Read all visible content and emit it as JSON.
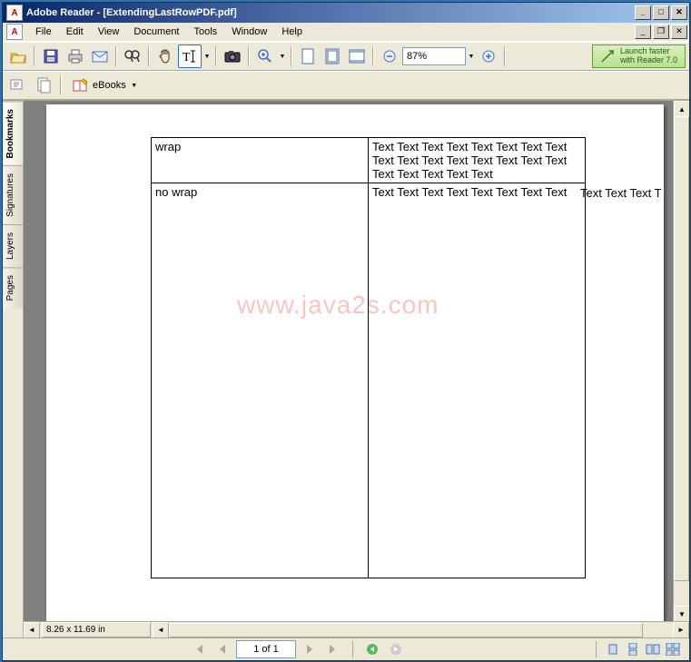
{
  "titlebar": {
    "app_name": "Adobe Reader",
    "doc_name": "[ExtendingLastRowPDF.pdf]"
  },
  "menu": {
    "file": "File",
    "edit": "Edit",
    "view": "View",
    "document": "Document",
    "tools": "Tools",
    "window": "Window",
    "help": "Help"
  },
  "toolbar": {
    "zoom_pct": "87%",
    "promo_line1": "Launch faster",
    "promo_line2": "with Reader 7.0",
    "ebooks": "eBooks"
  },
  "sidebar": {
    "bookmarks": "Bookmarks",
    "signatures": "Signatures",
    "layers": "Layers",
    "pages": "Pages"
  },
  "document_content": {
    "watermark": "www.java2s.com",
    "row1": {
      "c1": "wrap",
      "c2": "Text Text Text Text Text Text Text Text Text Text Text Text Text Text Text Text Text Text Text Text Text"
    },
    "row2": {
      "c1": "no wrap",
      "c2": "Text Text Text Text Text Text Text Text",
      "overflow": "Text Text Text T"
    }
  },
  "status": {
    "page_size": "8.26 x 11.69 in",
    "page_indicator": "1 of 1"
  }
}
